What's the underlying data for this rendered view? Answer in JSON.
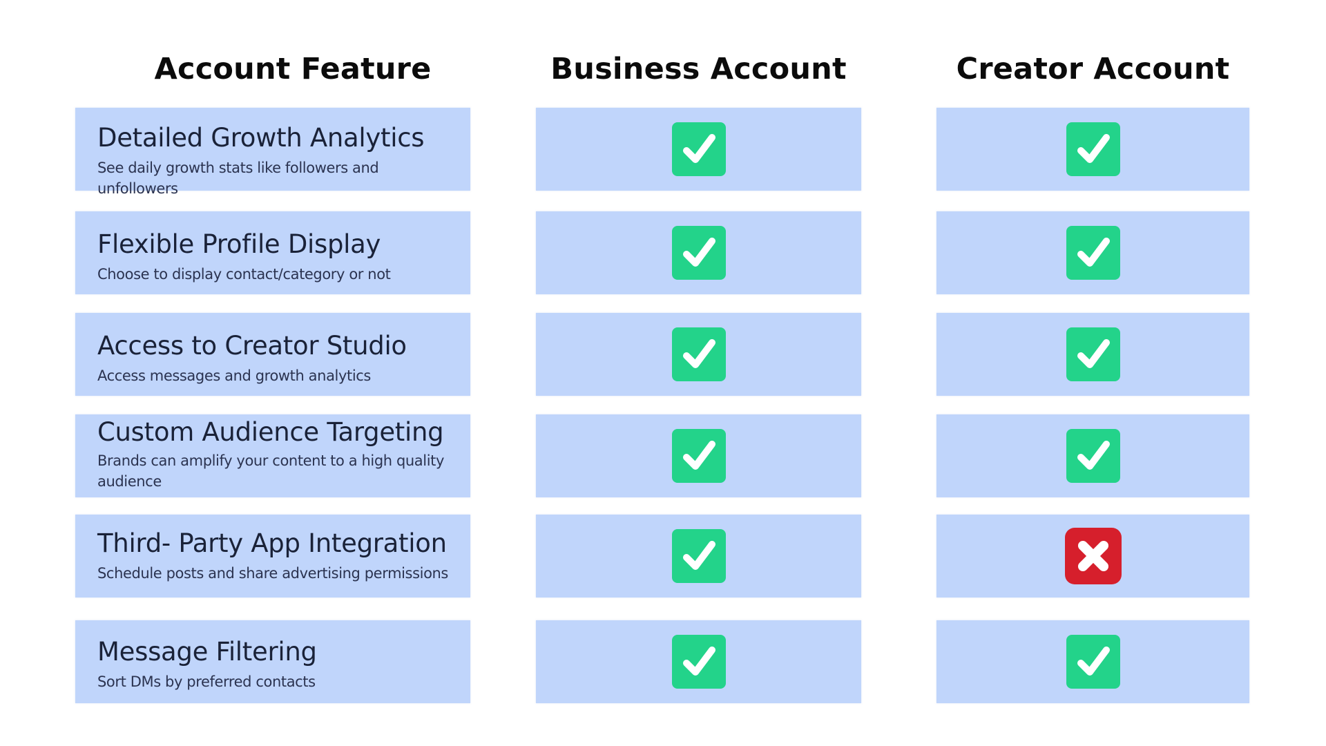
{
  "headers": {
    "feature": "Account Feature",
    "business": "Business Account",
    "creator": "Creator Account"
  },
  "colors": {
    "row_background": "#c0d5fb",
    "check_green": "#23d38a",
    "cross_red": "#d61f2c",
    "text_dark": "#1a2238"
  },
  "rows": [
    {
      "title": "Detailed Growth Analytics",
      "description": "See daily growth stats like followers and unfollowers",
      "business": "check-icon",
      "creator": "check-icon"
    },
    {
      "title": "Flexible Profile Display",
      "description": "Choose to display contact/category  or not",
      "business": "check-icon",
      "creator": "check-icon"
    },
    {
      "title": "Access to Creator Studio",
      "description": "Access messages and growth analytics",
      "business": "check-icon",
      "creator": "check-icon"
    },
    {
      "title": "Custom Audience Targeting",
      "description": "Brands can amplify your content to a high quality audience",
      "business": "check-icon",
      "creator": "check-icon"
    },
    {
      "title": "Third- Party App Integration",
      "description": "Schedule posts and share advertising permissions",
      "business": "check-icon",
      "creator": "cross-icon"
    },
    {
      "title": "Message Filtering",
      "description": "Sort DMs by preferred contacts",
      "business": "check-icon",
      "creator": "check-icon"
    }
  ]
}
